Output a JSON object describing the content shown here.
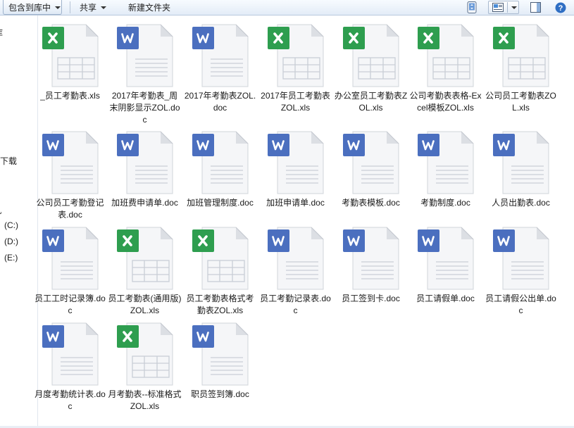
{
  "toolbar": {
    "include_label": "包含到库中",
    "share_label": "共享",
    "new_folder_label": "新建文件夹"
  },
  "nav": {
    "partial_top": "库",
    "downloads": "下载",
    "partial_computer": "机",
    "drive_c": "(C:)",
    "drive_d": "(D:)",
    "drive_e": "(E:)"
  },
  "colors": {
    "excel_badge": "#2e9e4f",
    "word_badge": "#4b6fbf",
    "toolbar_bg": "#e3ecf7"
  },
  "files": [
    {
      "name": "_员工考勤表.xls",
      "type": "xls"
    },
    {
      "name": "2017年考勤表_周末阴影显示ZOL.doc",
      "type": "doc"
    },
    {
      "name": "2017年考勤表ZOL.doc",
      "type": "doc"
    },
    {
      "name": "2017年员工考勤表ZOL.xls",
      "type": "xls"
    },
    {
      "name": "办公室员工考勤表ZOL.xls",
      "type": "xls"
    },
    {
      "name": "公司考勤表表格-Excel模板ZOL.xls",
      "type": "xls"
    },
    {
      "name": "公司员工考勤表ZOL.xls",
      "type": "xls"
    },
    {
      "name": "公司员工考勤登记表.doc",
      "type": "doc"
    },
    {
      "name": "加班费申请单.doc",
      "type": "doc"
    },
    {
      "name": "加班管理制度.doc",
      "type": "doc"
    },
    {
      "name": "加班申请单.doc",
      "type": "doc"
    },
    {
      "name": "考勤表模板.doc",
      "type": "doc"
    },
    {
      "name": "考勤制度.doc",
      "type": "doc"
    },
    {
      "name": "人员出勤表.doc",
      "type": "doc"
    },
    {
      "name": "员工工时记录簿.doc",
      "type": "doc"
    },
    {
      "name": "员工考勤表(通用版)ZOL.xls",
      "type": "xls"
    },
    {
      "name": "员工考勤表格式考勤表ZOL.xls",
      "type": "xls"
    },
    {
      "name": "员工考勤记录表.doc",
      "type": "doc"
    },
    {
      "name": "员工签到卡.doc",
      "type": "doc"
    },
    {
      "name": "员工请假单.doc",
      "type": "doc"
    },
    {
      "name": "员工请假公出单.doc",
      "type": "doc"
    },
    {
      "name": "月度考勤统计表.doc",
      "type": "doc"
    },
    {
      "name": "月考勤表--标准格式ZOL.xls",
      "type": "xls"
    },
    {
      "name": "职员签到簿.doc",
      "type": "doc"
    }
  ]
}
